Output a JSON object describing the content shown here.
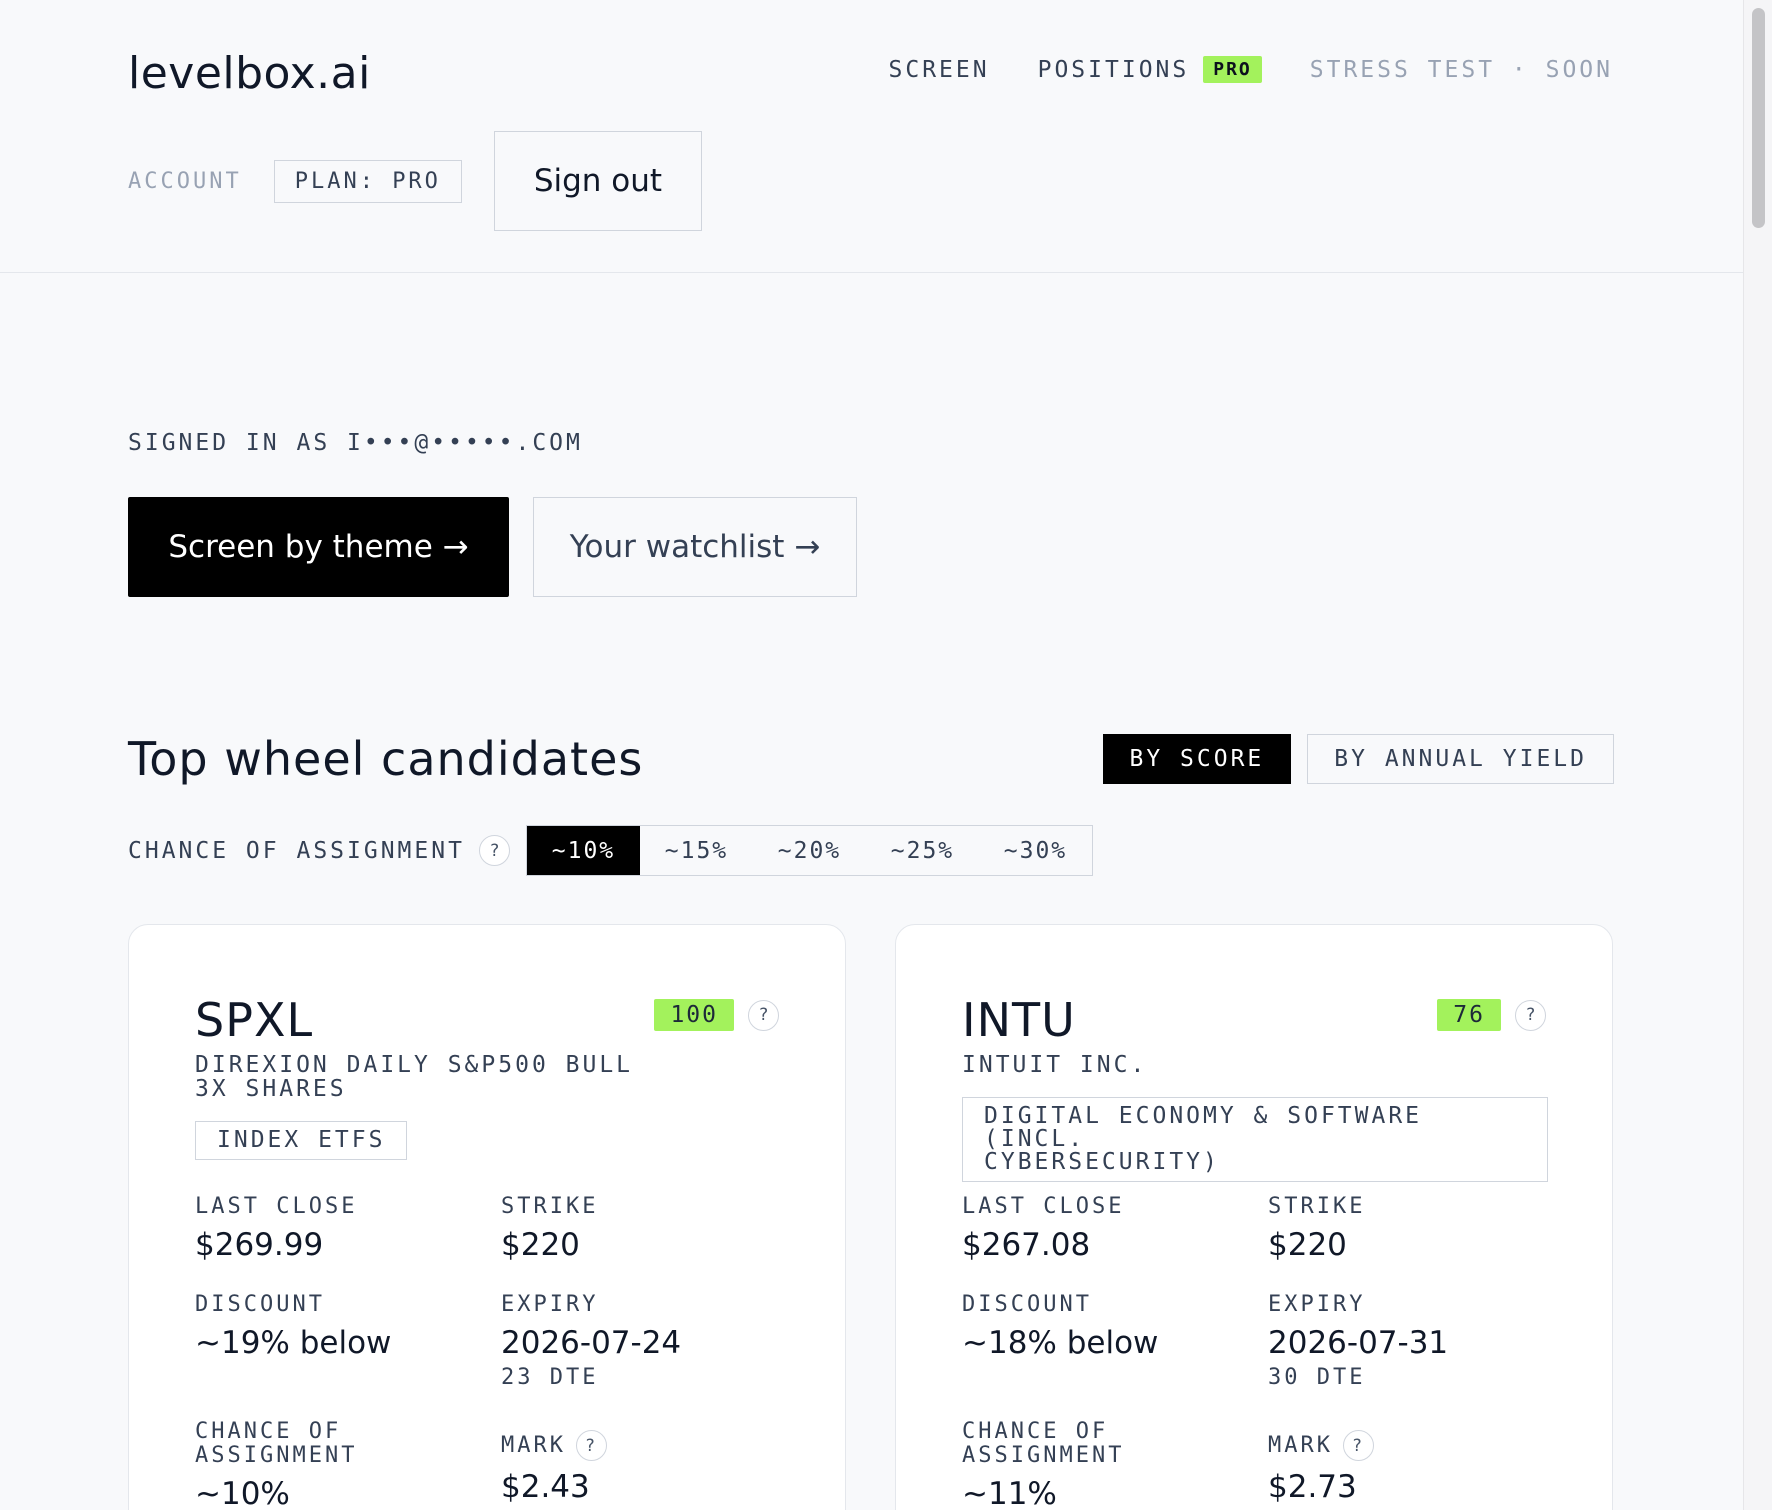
{
  "header": {
    "logo": "levelbox.ai",
    "nav": {
      "screen": "SCREEN",
      "positions": "POSITIONS",
      "positions_badge": "PRO",
      "stress_test": "STRESS TEST · SOON"
    },
    "account_label": "ACCOUNT",
    "plan_chip": "PLAN: PRO",
    "signout": "Sign out"
  },
  "main": {
    "signed_in_as": "SIGNED IN AS I•••@•••••.COM",
    "cta_primary": "Screen by theme →",
    "cta_secondary": "Your watchlist →",
    "section_title": "Top wheel candidates",
    "sort": {
      "by_score": "BY SCORE",
      "by_yield": "BY ANNUAL YIELD",
      "active": "BY SCORE"
    },
    "coa": {
      "label": "CHANCE OF ASSIGNMENT",
      "help": "?",
      "options": [
        "~10%",
        "~15%",
        "~20%",
        "~25%",
        "~30%"
      ],
      "selected": "~10%"
    }
  },
  "labels": {
    "last_close": "LAST CLOSE",
    "strike": "STRIKE",
    "discount": "DISCOUNT",
    "expiry": "EXPIRY",
    "chance_line1": "CHANCE OF",
    "chance_line2": "ASSIGNMENT",
    "mark": "MARK"
  },
  "cards": [
    {
      "ticker": "SPXL",
      "score": "100",
      "company_line1": "DIREXION DAILY S&P500 BULL",
      "company_line2": "3X SHARES",
      "sector_line1": "INDEX ETFS",
      "sector_line2": "",
      "last_close": "$269.99",
      "strike": "$220",
      "discount": "~19% below",
      "expiry": "2026-07-24",
      "dte": "23 DTE",
      "chance": "~10%",
      "mark": "$2.43"
    },
    {
      "ticker": "INTU",
      "score": "76",
      "company_line1": "INTUIT INC.",
      "company_line2": "",
      "sector_line1": "DIGITAL ECONOMY & SOFTWARE (INCL.",
      "sector_line2": "CYBERSECURITY)",
      "last_close": "$267.08",
      "strike": "$220",
      "discount": "~18% below",
      "expiry": "2026-07-31",
      "dte": "30 DTE",
      "chance": "~11%",
      "mark": "$2.73"
    }
  ],
  "colors": {
    "accent_green": "#a3f25c",
    "background": "#f8f9fb",
    "primary_button": "#000000"
  }
}
